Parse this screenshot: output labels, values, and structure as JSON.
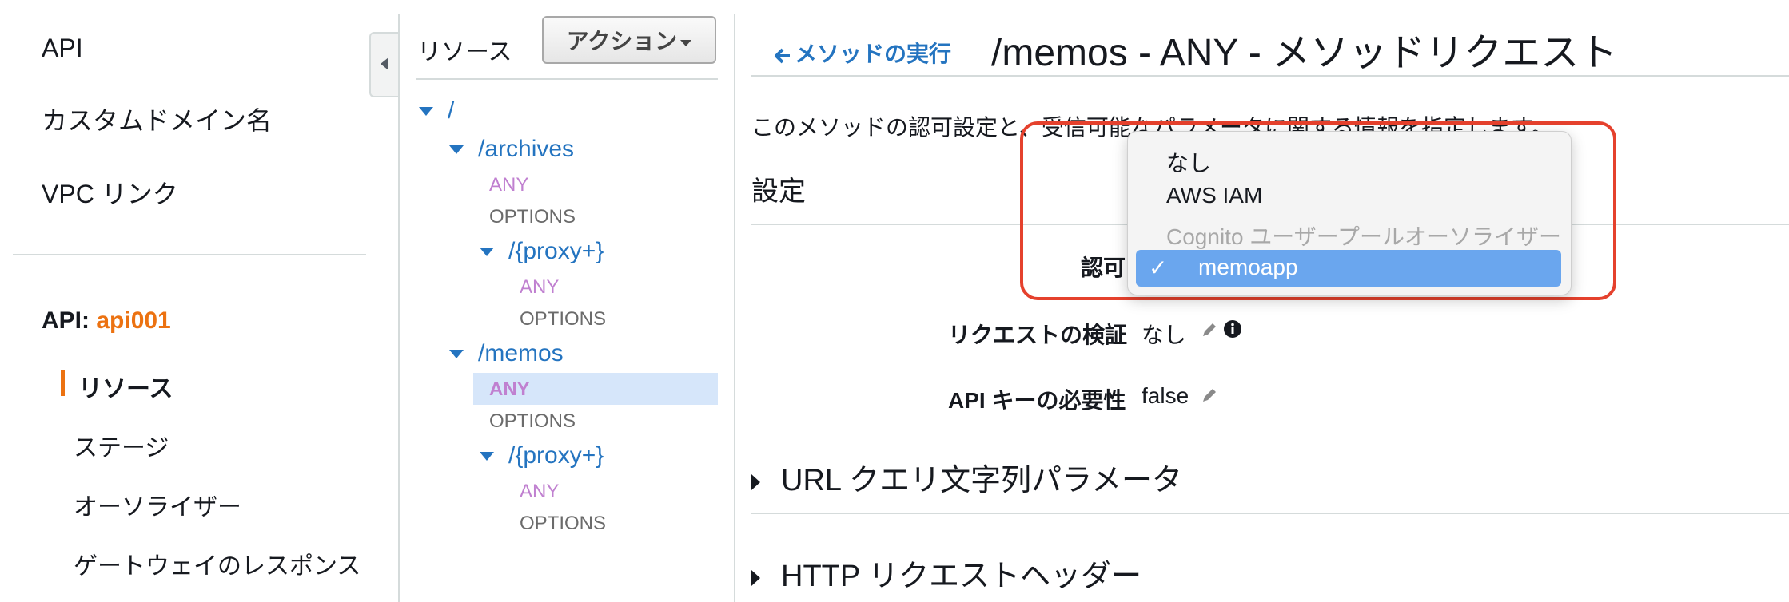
{
  "nav": {
    "items": [
      "API",
      "カスタムドメイン名",
      "VPC リンク"
    ],
    "api_prefix": "API:",
    "api_name": "api001",
    "sub_items": [
      "リソース",
      "ステージ",
      "オーソライザー",
      "ゲートウェイのレスポンス"
    ]
  },
  "resources": {
    "title": "リソース",
    "action_label": "アクション",
    "tree": {
      "root": "/",
      "archives": "/archives",
      "archives_any": "ANY",
      "archives_options": "OPTIONS",
      "archives_proxy": "/{proxy+}",
      "archives_proxy_any": "ANY",
      "archives_proxy_options": "OPTIONS",
      "memos": "/memos",
      "memos_any": "ANY",
      "memos_options": "OPTIONS",
      "memos_proxy": "/{proxy+}",
      "memos_proxy_any": "ANY",
      "memos_proxy_options": "OPTIONS"
    }
  },
  "main": {
    "back_link": "メソッドの実行",
    "title": "/memos - ANY - メソッドリクエスト",
    "description": "このメソッドの認可設定と、受信可能なパラメータに関する情報を指定します。",
    "settings_heading": "設定",
    "auth_label": "認可",
    "request_validation_label": "リクエストの検証",
    "request_validation_value": "なし",
    "api_key_label": "API キーの必要性",
    "api_key_value": "false",
    "url_query_section": "URL クエリ文字列パラメータ",
    "http_headers_section": "HTTP リクエストヘッダー"
  },
  "auth_dropdown": {
    "options": [
      "なし",
      "AWS IAM",
      "Cognito ユーザープールオーソライザー"
    ],
    "selected": "memoapp",
    "check": "✓"
  },
  "colors": {
    "link": "#2474c0",
    "accent": "#ec7211",
    "method_any": "#c080d0",
    "highlight": "#e5412d",
    "selected_option": "#6aa6ee"
  }
}
